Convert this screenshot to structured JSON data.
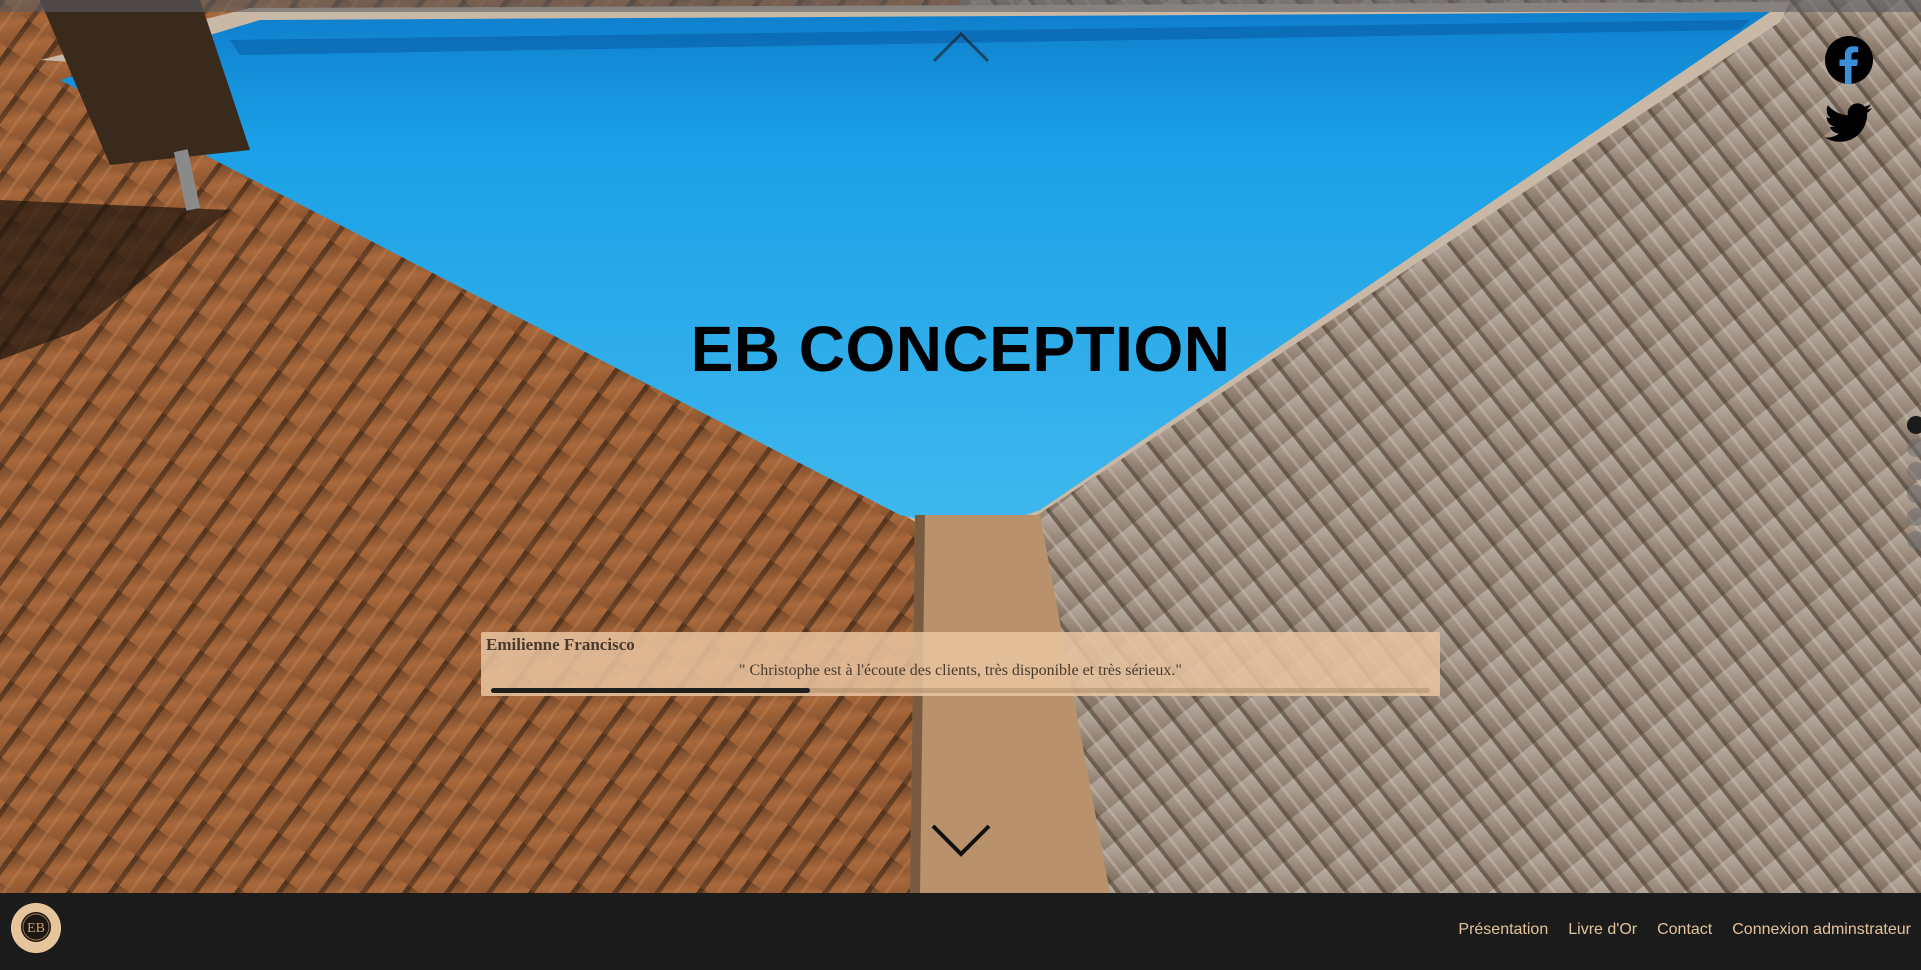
{
  "hero": {
    "title": "EB CONCEPTION",
    "scroll_up_icon": "chevron-up-icon",
    "scroll_down_icon": "chevron-down-icon"
  },
  "social": [
    {
      "icon": "facebook-icon"
    },
    {
      "icon": "twitter-icon"
    }
  ],
  "section_dots": {
    "count": 6,
    "active_index": 0
  },
  "review": {
    "author": "Emilienne Francisco",
    "quote": "\" Christophe est à l'écoute des clients, très disponible et très sérieux.\"",
    "progress": 0.34
  },
  "navbar": {
    "logo_icon": "eb-logo-icon",
    "links": [
      {
        "label": "Présentation"
      },
      {
        "label": "Livre d'Or"
      },
      {
        "label": "Contact"
      },
      {
        "label": "Connexion adminstrateur"
      }
    ]
  },
  "colors": {
    "pool": "#1aa3e8",
    "deck_warm": "#a0643a",
    "deck_grey": "#9c8d80",
    "navbar_bg": "#1b1b1b",
    "nav_link": "#e3c39c",
    "review_bg": "#e8c4a0"
  }
}
